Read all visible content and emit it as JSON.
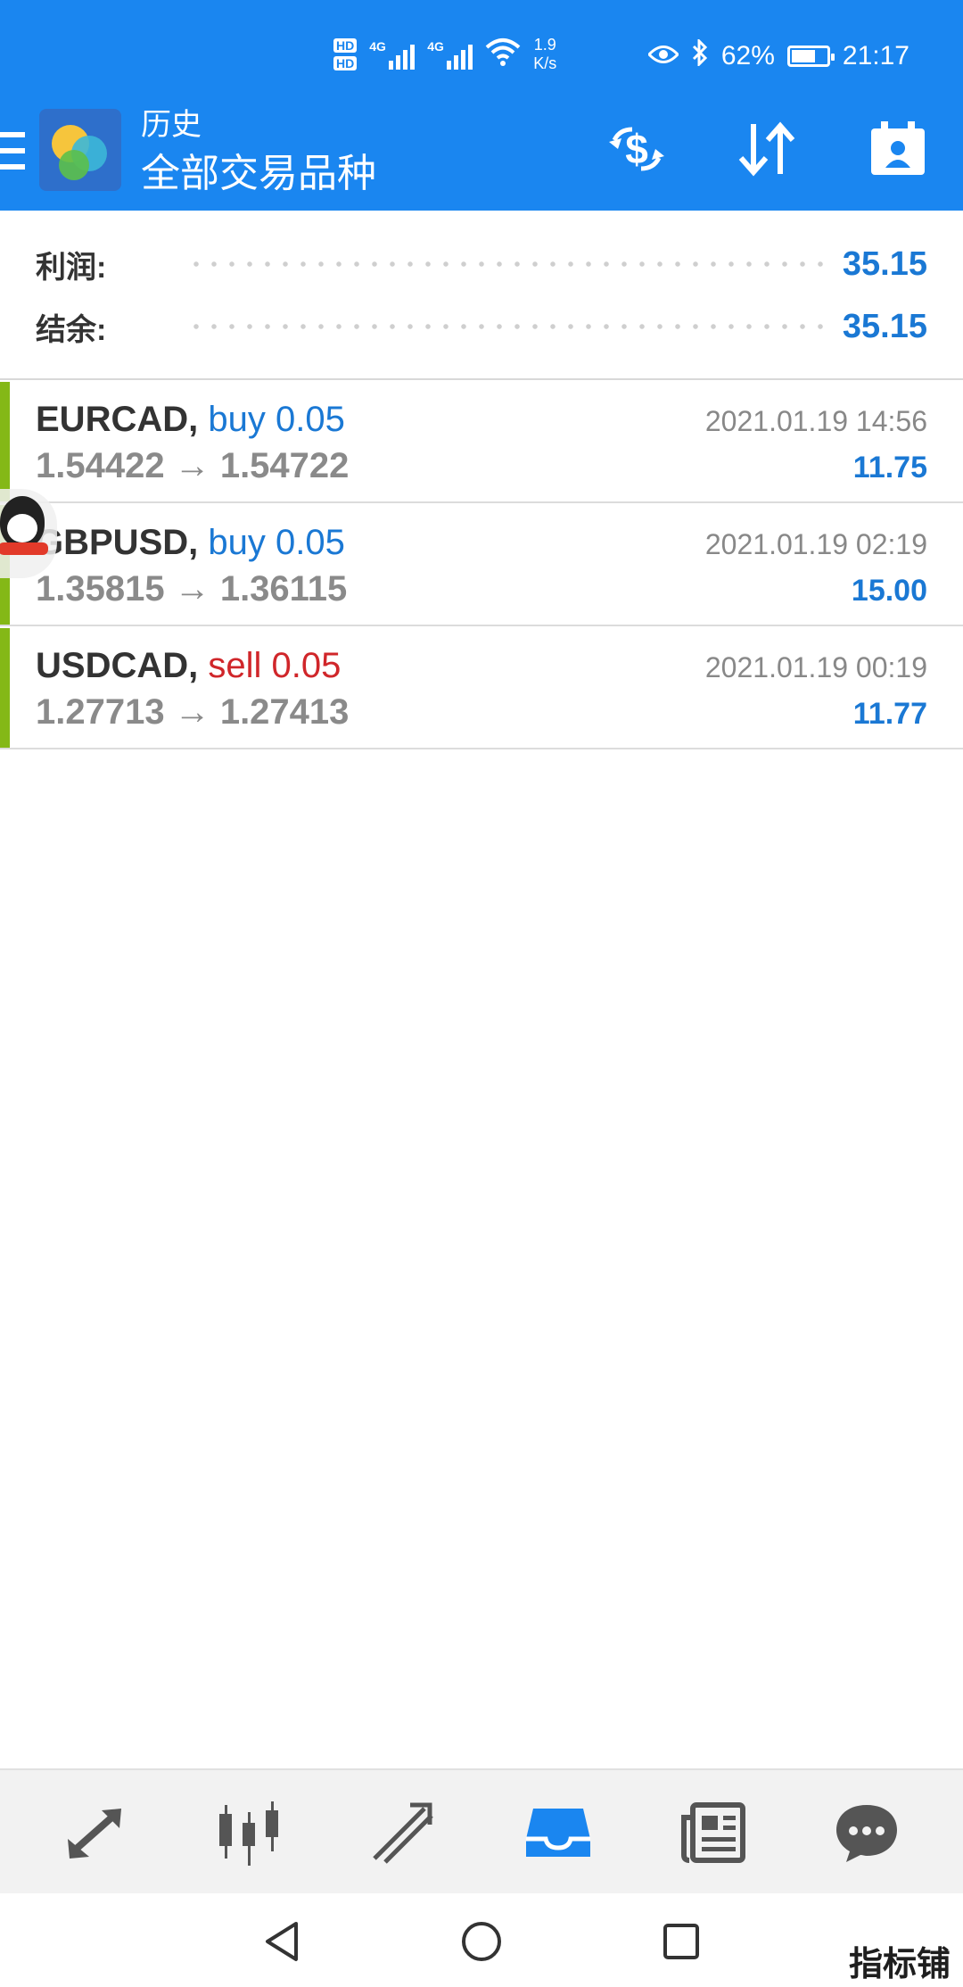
{
  "status_bar": {
    "sim1": "HD",
    "sim2": "HD",
    "net1": "4G",
    "net2": "4G",
    "speed_value": "1.9",
    "speed_unit": "K/s",
    "battery": "62%",
    "battery_level": 0.62,
    "time": "21:17"
  },
  "app_bar": {
    "title": "历史",
    "subtitle": "全部交易品种"
  },
  "summary": {
    "profit_label": "利润:",
    "profit_value": "35.15",
    "balance_label": "结余:",
    "balance_value": "35.15"
  },
  "deals": [
    {
      "symbol": "EURCAD,",
      "side": "buy 0.05",
      "prices": "1.54422 → 1.54722",
      "time": "2021.01.19 14:56",
      "profit": "11.75"
    },
    {
      "symbol": "GBPUSD,",
      "side": "buy 0.05",
      "prices": "1.35815 → 1.36115",
      "time": "2021.01.19 02:19",
      "profit": "15.00"
    },
    {
      "symbol": "USDCAD,",
      "side": "sell 0.05",
      "prices": "1.27713 → 1.27413",
      "time": "2021.01.19 00:19",
      "profit": "11.77"
    }
  ],
  "nav": {
    "icons": [
      "quotes-icon",
      "chart-icon",
      "trade-icon",
      "history-icon",
      "news-icon",
      "chat-icon"
    ],
    "active": "history-icon",
    "active_color": "#1a86f0",
    "inactive_color": "#555555"
  },
  "watermark": "指标铺",
  "colors": {
    "primary": "#1a86f0",
    "value_blue": "#1a78d4",
    "sell_red": "#d0262a",
    "profit_bar": "#84b817"
  }
}
